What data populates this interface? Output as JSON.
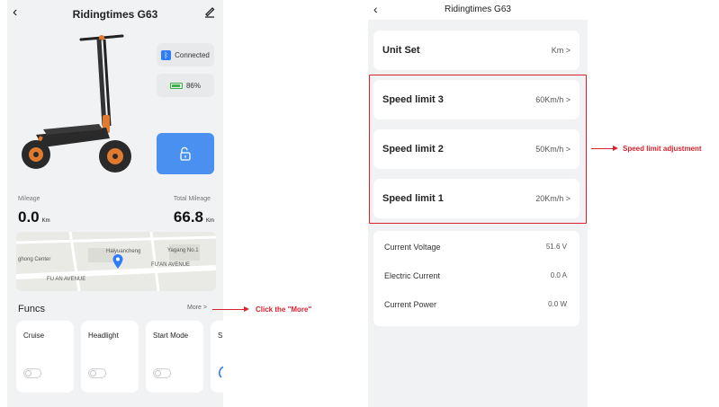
{
  "left_screen": {
    "title": "Ridingtimes G63",
    "back_glyph": "‹",
    "status": {
      "connection": "Connected",
      "battery": "86%",
      "battery_level": 0.86
    },
    "stats": {
      "mileage_label": "Mileage",
      "mileage_value": "0.0",
      "mileage_unit": "Km",
      "total_label": "Total Mileage",
      "total_value": "66.8",
      "total_unit": "Km"
    },
    "map": {
      "labels": [
        "Haiyuancheng",
        "Yagang No.1",
        "ghong Center",
        "FU AN AVENUE",
        "FU'AN AVENUE"
      ]
    },
    "funcs": {
      "title": "Funcs",
      "more": "More >",
      "items": [
        {
          "label": "Cruise"
        },
        {
          "label": "Headlight"
        },
        {
          "label": "Start Mode"
        },
        {
          "label": "S"
        }
      ]
    },
    "icons": {
      "back": "back-chevron-icon",
      "edit": "edit-pencil-icon",
      "bluetooth": "bluetooth-icon",
      "battery": "battery-icon",
      "lock": "unlock-icon",
      "map_pin": "location-pin-icon"
    }
  },
  "annotations": {
    "more_note": "Click the \"More\"",
    "speed_note": "Speed limit adjustment",
    "color": "#d9232e"
  },
  "right_screen": {
    "title": "Ridingtimes G63",
    "back_glyph": "‹",
    "unit_set": {
      "label": "Unit Set",
      "value": "Km >"
    },
    "speed_limits": [
      {
        "label": "Speed limit 3",
        "value": "60Km/h >"
      },
      {
        "label": "Speed limit 2",
        "value": "50Km/h >"
      },
      {
        "label": "Speed limit 1",
        "value": "20Km/h >"
      }
    ],
    "info": [
      {
        "label": "Current Voltage",
        "value": "51.6 V"
      },
      {
        "label": "Electric Current",
        "value": "0.0 A"
      },
      {
        "label": "Current Power",
        "value": "0.0 W"
      }
    ]
  },
  "colors": {
    "accent_blue": "#4a90f0",
    "bluetooth_blue": "#2f7cf6",
    "battery_green": "#3bb24a",
    "annotation_red": "#d9232e"
  }
}
